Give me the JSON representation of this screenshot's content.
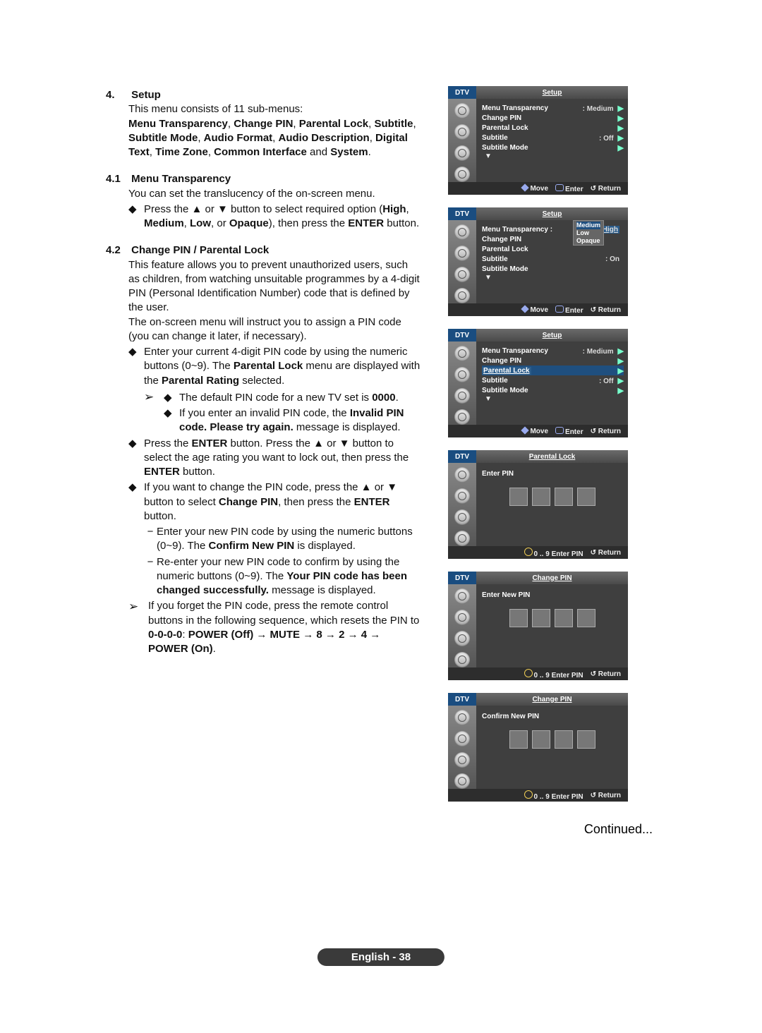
{
  "section4": {
    "num": "4.",
    "title": "Setup",
    "intro": "This menu consists of 11 sub-menus:",
    "menulist1": "Menu Transparency",
    "sep1": ", ",
    "m2": "Change PIN",
    "m3": "Parental Lock",
    "m4": "Subtitle",
    "m5": "Subtitle Mode",
    "m6": "Audio Format",
    "m7": "Audio Description",
    "m8": "Digital Text",
    "m9": "Time Zone",
    "m10": "Common Interface",
    "and": " and ",
    "m11": "System",
    "dot": "."
  },
  "s41": {
    "num": "4.1",
    "title": "Menu Transparency",
    "l1": "You can set the translucency of the on-screen menu.",
    "b1a": "Press the ▲ or ▼ button to select required option (",
    "high": "High",
    "med": "Medium",
    "low": "Low",
    "opq": "Opaque",
    "b1b": "), then press the ",
    "enter": "ENTER",
    "b1c": " button."
  },
  "s42": {
    "num": "4.2",
    "title": "Change PIN / Parental Lock",
    "p1": "This feature allows you to prevent unauthorized users, such as children, from watching unsuitable programmes by a 4-digit PIN (Personal Identification Number) code that is defined by the user.",
    "p2": "The on-screen menu will instruct you to assign a PIN code (you can change it later, if necessary).",
    "b1a": "Enter your current 4-digit PIN code by using the numeric buttons (0~9). The ",
    "pl": "Parental Lock",
    "b1b": " menu are displayed with the ",
    "pr": "Parental Rating",
    "b1c": " selected.",
    "a1a": "The default PIN code for a new TV set is ",
    "zeros": "0000",
    "a2a": "If you enter an invalid PIN code, the ",
    "inv": "Invalid PIN code. Please try again.",
    "a2b": " message is displayed.",
    "b2a": "Press the ",
    "ent": "ENTER",
    "b2b": " button. Press the ▲ or ▼ button to select the age rating you want to lock out, then press the ",
    "b2c": " button.",
    "b3a": "If you want to change the PIN code, press the ▲ or ▼ button to select ",
    "cp": "Change PIN",
    "b3b": ", then press the ",
    "b3c": " button.",
    "d1a": "Enter your new PIN code by using the numeric buttons (0~9). The ",
    "cnp": "Confirm New PIN",
    "d1b": " is displayed.",
    "d2a": "Re-enter your new PIN code to confirm by using the numeric buttons (0~9). The ",
    "suc": "Your PIN code has been changed successfully.",
    "d2b": " message is displayed.",
    "fa": "If you forget the PIN code, press the remote control buttons in the following sequence, which resets the PIN to ",
    "seq": "0-0-0-0",
    "seq2": ": ",
    "pw": "POWER (Off)",
    "ar": " → ",
    "mu": "MUTE",
    "n8": "8",
    "n2": "2",
    "n4": "4",
    "pon": "POWER (On)",
    "fdot": "."
  },
  "osd": {
    "dtv": "DTV",
    "setup": "Setup",
    "plTitle": "Parental Lock",
    "cpTitle": "Change PIN",
    "r_mt": "Menu Transparency",
    "r_cp": "Change PIN",
    "r_pl": "Parental Lock",
    "r_sub": "Subtitle",
    "r_sm": "Subtitle Mode",
    "val_med": ": Medium",
    "val_off": ": Off",
    "val_on": ": On",
    "dd_high": "High",
    "dd_med": "Medium",
    "dd_low": "Low",
    "dd_opq": "Opaque",
    "help_move": "Move",
    "help_enter": "Enter",
    "help_return": "Return",
    "help_epin": "Enter PIN",
    "enterPin": "Enter PIN",
    "enterNew": "Enter New PIN",
    "confirmNew": "Confirm New PIN",
    "digits": "0 .. 9"
  },
  "continued": "Continued...",
  "footer": "English - 38"
}
